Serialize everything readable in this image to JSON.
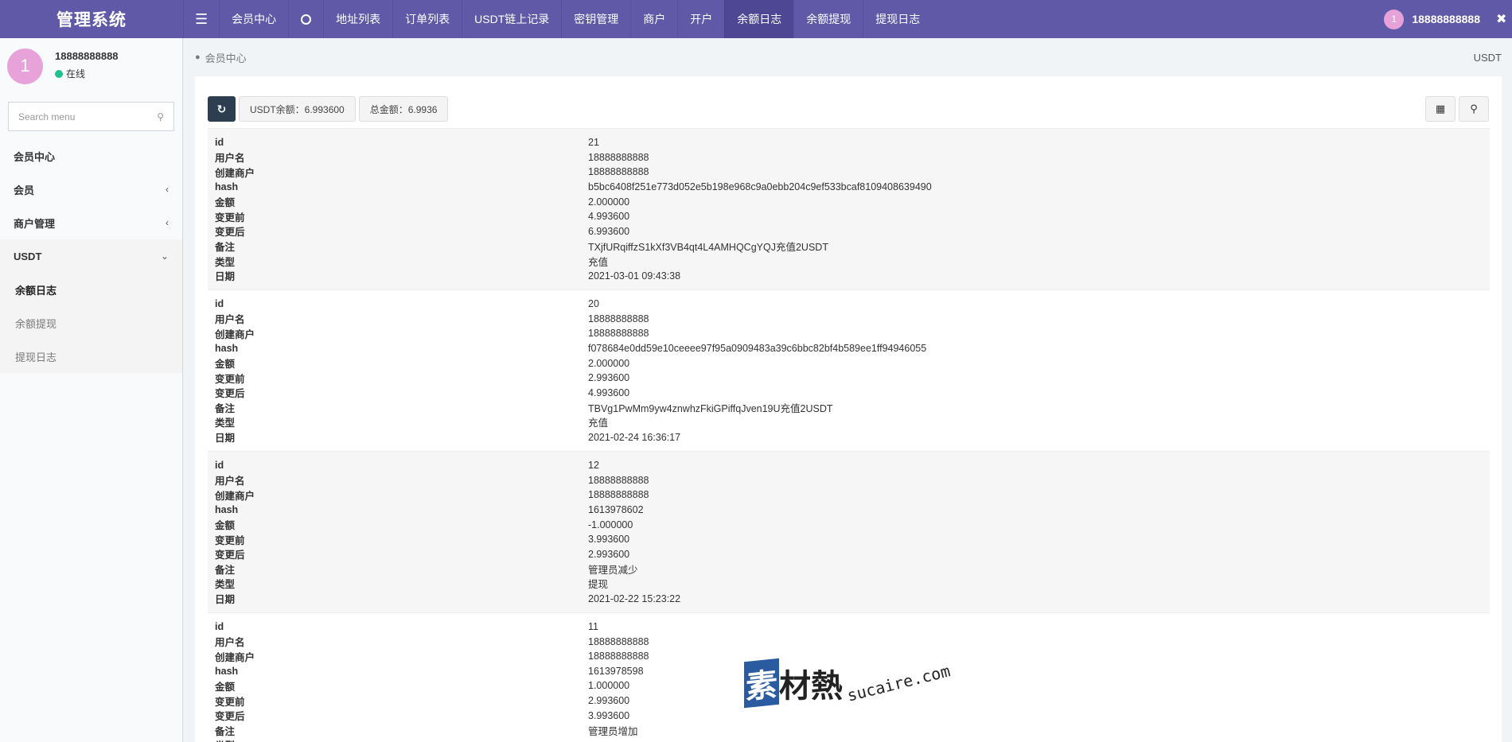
{
  "header": {
    "title": "管理系统",
    "nav": [
      {
        "label": "会员中心",
        "active": false
      },
      {
        "label": "地址列表",
        "active": false
      },
      {
        "label": "订单列表",
        "active": false
      },
      {
        "label": "USDT链上记录",
        "active": false
      },
      {
        "label": "密钥管理",
        "active": false
      },
      {
        "label": "商户",
        "active": false
      },
      {
        "label": "开户",
        "active": false
      },
      {
        "label": "余额日志",
        "active": true
      },
      {
        "label": "余额提现",
        "active": false
      },
      {
        "label": "提现日志",
        "active": false
      }
    ],
    "user_avatar": "1",
    "user_name": "18888888888"
  },
  "sidebar": {
    "avatar": "1",
    "user_name": "18888888888",
    "status": "在线",
    "search_placeholder": "Search menu",
    "menu": [
      {
        "label": "会员中心"
      },
      {
        "label": "会员"
      },
      {
        "label": "商户管理"
      },
      {
        "label": "USDT"
      }
    ],
    "submenu": [
      {
        "label": "余额日志",
        "active": true
      },
      {
        "label": "余额提现",
        "active": false
      },
      {
        "label": "提现日志",
        "active": false
      }
    ]
  },
  "content": {
    "breadcrumb": "会员中心",
    "right_label": "USDT",
    "usdt_balance": "USDT余额：6.993600",
    "total_balance": "总金额：6.9936"
  },
  "field_labels": [
    "id",
    "用户名",
    "创建商户",
    "hash",
    "金额",
    "变更前",
    "变更后",
    "备注",
    "类型",
    "日期"
  ],
  "records": [
    {
      "id": "21",
      "username": "18888888888",
      "merchant": "18888888888",
      "hash": "b5bc6408f251e773d052e5b198e968c9a0ebb204c9ef533bcaf8109408639490",
      "amount": "2.000000",
      "before": "4.993600",
      "after": "6.993600",
      "remark": "TXjfURqiffzS1kXf3VB4qt4L4AMHQCgYQJ充值2USDT",
      "type": "充值",
      "date": "2021-03-01 09:43:38"
    },
    {
      "id": "20",
      "username": "18888888888",
      "merchant": "18888888888",
      "hash": "f078684e0dd59e10ceeee97f95a0909483a39c6bbc82bf4b589ee1ff94946055",
      "amount": "2.000000",
      "before": "2.993600",
      "after": "4.993600",
      "remark": "TBVg1PwMm9yw4znwhzFkiGPiffqJven19U充值2USDT",
      "type": "充值",
      "date": "2021-02-24 16:36:17"
    },
    {
      "id": "12",
      "username": "18888888888",
      "merchant": "18888888888",
      "hash": "1613978602",
      "amount": "-1.000000",
      "before": "3.993600",
      "after": "2.993600",
      "remark": "管理员减少",
      "type": "提现",
      "date": "2021-02-22 15:23:22"
    },
    {
      "id": "11",
      "username": "18888888888",
      "merchant": "18888888888",
      "hash": "1613978598",
      "amount": "1.000000",
      "before": "2.993600",
      "after": "3.993600",
      "remark": "管理员增加",
      "type": "",
      "date": ""
    }
  ],
  "watermark": {
    "logo_first": "素",
    "logo_rest": "材熱",
    "url": "sucaire.com"
  }
}
